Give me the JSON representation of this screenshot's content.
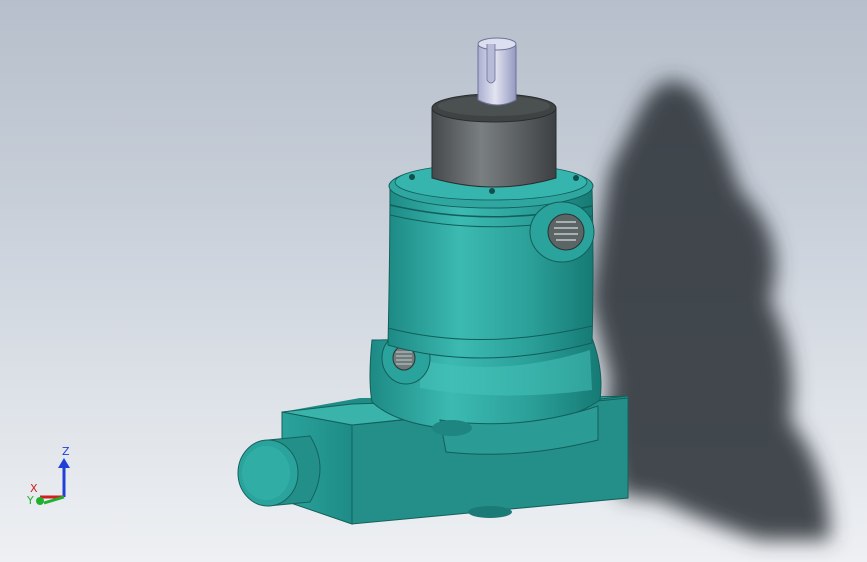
{
  "viewport": {
    "background_top": "#b6bfcb",
    "background_bottom": "#eef0f3"
  },
  "model": {
    "body_color": "#2fa7a0",
    "cap_color": "#5f6567",
    "shaft_color": "#c9cde2"
  },
  "triad": {
    "z_label": "Z",
    "x_label": "X",
    "y_label": "Y",
    "z_color": "#2040d8",
    "x_color": "#d02020",
    "y_color": "#20b030"
  }
}
